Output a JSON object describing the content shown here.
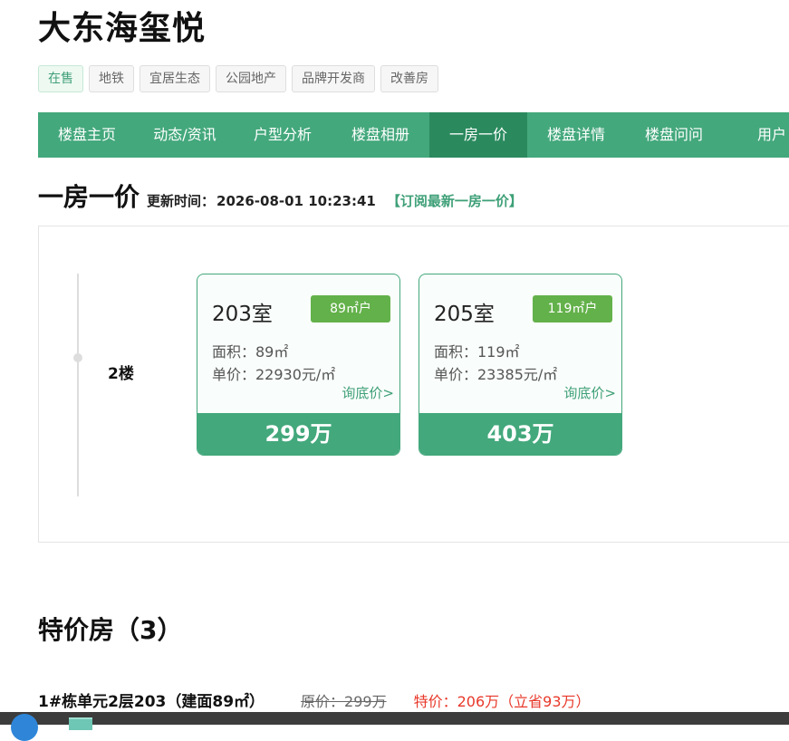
{
  "title": "大东海玺悦",
  "tags": [
    "在售",
    "地铁",
    "宜居生态",
    "公园地产",
    "品牌开发商",
    "改善房"
  ],
  "nav": [
    "楼盘主页",
    "动态/资讯",
    "户型分析",
    "楼盘相册",
    "一房一价",
    "楼盘详情",
    "楼盘问问",
    "用户"
  ],
  "nav_active": "一房一价",
  "section": {
    "title": "一房一价",
    "update_label": "更新时间：",
    "update_time": "2026-08-01 10:23:41",
    "subscribe": "【订阅最新一房一价】"
  },
  "floor": "2楼",
  "units": [
    {
      "room": "203室",
      "type": "89㎡户",
      "area": "面积：89㎡",
      "unit_price": "单价：22930元/㎡",
      "link": "询底价>",
      "total": "299万"
    },
    {
      "room": "205室",
      "type": "119㎡户",
      "area": "面积：119㎡",
      "unit_price": "单价：23385元/㎡",
      "link": "询底价>",
      "total": "403万"
    }
  ],
  "special": {
    "title": "特价房（3）",
    "items": [
      {
        "name": "1#栋单元2层203（建面89㎡）",
        "orig": "原价：299万",
        "price": "特价：206万（立省93万）"
      }
    ]
  },
  "colors": {
    "accent": "#43a87c",
    "active": "#2a8a5e",
    "badge": "#63b14a",
    "sale": "#e8382a"
  }
}
